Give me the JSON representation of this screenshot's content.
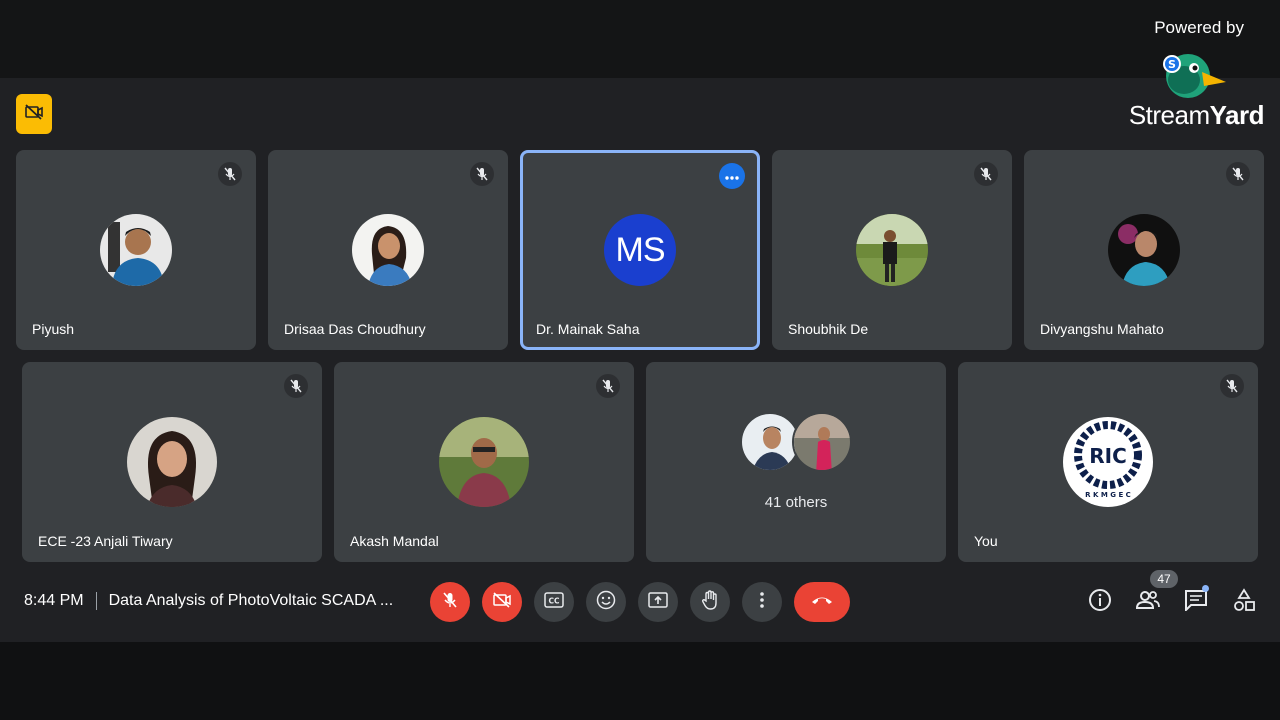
{
  "branding": {
    "powered_by": "Powered by",
    "logo_part1": "Stream",
    "logo_part2": "Yard"
  },
  "participants_row1": [
    {
      "name": "Piyush",
      "muted": true
    },
    {
      "name": "Drisaa Das Choudhury",
      "muted": true
    },
    {
      "name": "Dr. Mainak Saha",
      "initials": "MS",
      "active_speaker": true
    },
    {
      "name": "Shoubhik De",
      "muted": true
    },
    {
      "name": "Divyangshu Mahato",
      "muted": true
    }
  ],
  "participants_row2": [
    {
      "name": "ECE -23 Anjali Tiwary",
      "muted": true
    },
    {
      "name": "Akash Mandal",
      "muted": true
    },
    {
      "others_label": "41 others"
    },
    {
      "name": "You",
      "avatar_text": "R K M G E C",
      "muted": true
    }
  ],
  "controls": {
    "time": "8:44 PM",
    "meeting_title": "Data Analysis of PhotoVoltaic SCADA ...",
    "participant_count": "47"
  },
  "colors": {
    "stage_bg": "#202124",
    "tile_bg": "#3c4043",
    "active_border": "#8ab4f8",
    "danger": "#ea4335",
    "badge_yellow": "#fbbc04",
    "accent_blue": "#1a73e8"
  },
  "icons": [
    "camera-off-icon",
    "mic-off-icon",
    "more-options-icon",
    "captions-icon",
    "emoji-icon",
    "present-icon",
    "raise-hand-icon",
    "more-vert-icon",
    "hang-up-icon",
    "info-icon",
    "people-icon",
    "chat-icon",
    "activities-icon"
  ]
}
